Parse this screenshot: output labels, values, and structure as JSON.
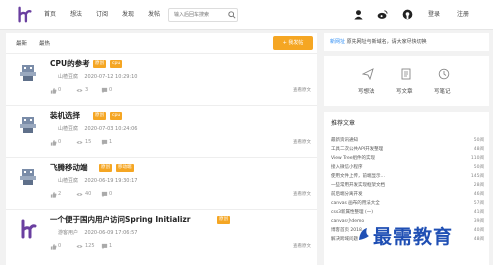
{
  "nav": {
    "items": [
      "首页",
      "想法",
      "订阅",
      "发现",
      "发帖"
    ],
    "search_placeholder": "输入后回车搜索",
    "login": "登录",
    "register": "注册"
  },
  "filters": [
    "最新",
    "最热"
  ],
  "post_button": "+ 我发帖",
  "posts": [
    {
      "title": "CPU的参考",
      "tags": [
        "原创",
        "cpu"
      ],
      "author": "山楂豆腐",
      "date": "2020-07-12 10:29:10",
      "likes": "0",
      "views": "3",
      "comments": "0",
      "view_label": "查看原文"
    },
    {
      "title": "装机选择",
      "tags": [
        "原创",
        "cpu"
      ],
      "author": "山楂豆腐",
      "date": "2020-07-03 10:24:06",
      "likes": "0",
      "views": "15",
      "comments": "1",
      "view_label": "查看原文"
    },
    {
      "title": "飞腾移动端",
      "tags": [
        "原创",
        "移动端"
      ],
      "author": "山楂豆腐",
      "date": "2020-06-19 19:30:17",
      "likes": "2",
      "views": "40",
      "comments": "0",
      "view_label": "查看原文"
    },
    {
      "title": "一个便于国内用户访问Spring Initializr",
      "tags": [
        "原创"
      ],
      "author": "游客用户",
      "date": "2020-06-09 17:06:57",
      "likes": "0",
      "views": "125",
      "comments": "1",
      "view_label": "查看原文"
    }
  ],
  "notice": {
    "text": "原先网址与新域名，请大家尽快切换",
    "link": "新网址"
  },
  "actions": [
    "写想法",
    "写文章",
    "写笔记"
  ],
  "recommend": {
    "title": "推荐文章",
    "items": [
      {
        "title": "最新资讯通知",
        "count": "50阅"
      },
      {
        "title": "工具二次公共API开发整理",
        "count": "48阅"
      },
      {
        "title": "View Tree组件的实现",
        "count": "110阅"
      },
      {
        "title": "接入微信小程序",
        "count": "50阅"
      },
      {
        "title": "使用文件上传，前端显示…",
        "count": "145阅"
      },
      {
        "title": "一些常用开发实现框架文档",
        "count": "28阅"
      },
      {
        "title": "前后端分离开发",
        "count": "46阅"
      },
      {
        "title": "canvas 画布的用法大全",
        "count": "57阅"
      },
      {
        "title": "css3新属性整理 (一)",
        "count": "41阅"
      },
      {
        "title": "canvas小demo",
        "count": "39阅"
      },
      {
        "title": "博客首页 2018…",
        "count": "40阅"
      },
      {
        "title": "解决跨域问题",
        "count": "48阅"
      }
    ]
  },
  "watermark": "最需教育",
  "colors": {
    "accent": "#f5a623",
    "brand": "#6a3fa0",
    "link": "#2e8ef5"
  }
}
